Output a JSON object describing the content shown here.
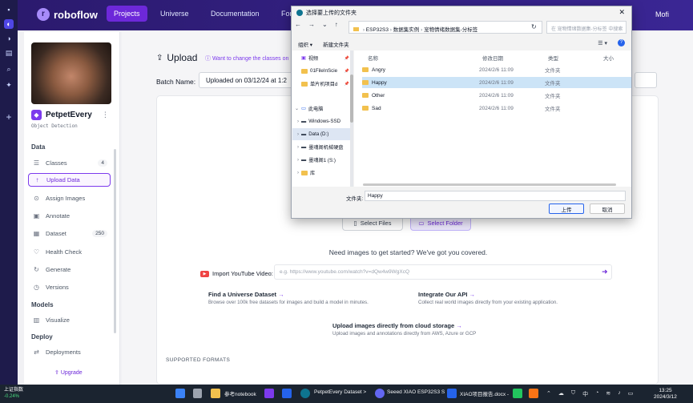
{
  "app": {
    "logo": "roboflow",
    "nav_tabs": [
      "Projects",
      "Universe",
      "Documentation",
      "For"
    ],
    "user": "Mofi"
  },
  "sidebar": {
    "project_name": "PetpetEvery",
    "project_type": "Object Detection",
    "sections": {
      "data": "Data",
      "models": "Models",
      "deploy": "Deploy"
    },
    "items": [
      {
        "label": "Classes",
        "badge": "4",
        "icon": "classes-icon"
      },
      {
        "label": "Upload Data",
        "icon": "upload-icon"
      },
      {
        "label": "Assign Images",
        "icon": "assign-icon"
      },
      {
        "label": "Annotate",
        "icon": "annotate-icon"
      },
      {
        "label": "Dataset",
        "badge": "250",
        "icon": "dataset-icon"
      },
      {
        "label": "Health Check",
        "icon": "health-icon"
      },
      {
        "label": "Generate",
        "icon": "generate-icon"
      },
      {
        "label": "Versions",
        "icon": "versions-icon"
      },
      {
        "label": "Visualize",
        "icon": "visualize-icon"
      },
      {
        "label": "Deployments",
        "icon": "deployments-icon"
      }
    ],
    "upgrade": "Upgrade"
  },
  "main": {
    "title": "Upload",
    "change_link": "Want to change the classes on",
    "batch_label": "Batch Name:",
    "batch_value": "Uploaded on 03/12/24 at 1:2",
    "select_files": "Select Files",
    "select_folder": "Select Folder",
    "need_images": "Need images to get started? We've got you covered.",
    "youtube_label": "Import YouTube Video:",
    "youtube_placeholder": "e.g. https://www.youtube.com/watch?v=dQw4w9WgXcQ",
    "options": [
      {
        "title": "Find a Universe Dataset",
        "desc": "Browse over 100k free datasets for images and build a model in minutes."
      },
      {
        "title": "Integrate Our API",
        "desc": "Collect real world images directly from your existing application."
      },
      {
        "title": "Upload images directly from cloud storage",
        "desc": "Upload images and annotations directly from AWS, Azure or GCP"
      }
    ],
    "supported": "SUPPORTED FORMATS"
  },
  "dialog": {
    "title": "选择要上传的文件夹",
    "path": [
      "ESP32S3",
      "数据集实例",
      "宠物情绪数据集-分标签"
    ],
    "search_placeholder": "在 宠物情绪数据集-分标签 中搜索",
    "organize": "组织 ▾",
    "new_folder": "新建文件夹",
    "tree": [
      {
        "label": "视频",
        "pinned": true
      },
      {
        "label": "01FileInScie",
        "pinned": true
      },
      {
        "label": "单片机项目d",
        "pinned": true
      },
      {
        "label": "此电脑",
        "expanded": true
      },
      {
        "label": "Windows-SSD"
      },
      {
        "label": "Data (D:)",
        "selected": true
      },
      {
        "label": "墨魂阁机械硬盘"
      },
      {
        "label": "墨魂阁1 (S:)"
      },
      {
        "label": "库"
      }
    ],
    "columns": [
      "名称",
      "修改日期",
      "类型",
      "大小"
    ],
    "files": [
      {
        "name": "Angry",
        "date": "2024/2/6 11:09",
        "type": "文件夹"
      },
      {
        "name": "Happy",
        "date": "2024/2/6 11:09",
        "type": "文件夹",
        "selected": true
      },
      {
        "name": "Other",
        "date": "2024/2/6 11:09",
        "type": "文件夹"
      },
      {
        "name": "Sad",
        "date": "2024/2/6 11:09",
        "type": "文件夹"
      }
    ],
    "folder_label": "文件夹:",
    "folder_value": "Happy",
    "upload_btn": "上传",
    "cancel_btn": "取消"
  },
  "taskbar": {
    "stock_name": "上证指数",
    "stock_change": "-0.24%",
    "tasks": [
      "参考notebook",
      "PetpetEvery Dataset >",
      "Seeed XIAO ESP32S3 S",
      "XIAO项目报告.docx -"
    ],
    "tray_lang": "中",
    "time": "13:25",
    "date": "2024/3/12"
  },
  "colors": {
    "nav_bg": "#2f1f7a",
    "accent": "#7c3aed",
    "selection": "#cce4f7"
  }
}
